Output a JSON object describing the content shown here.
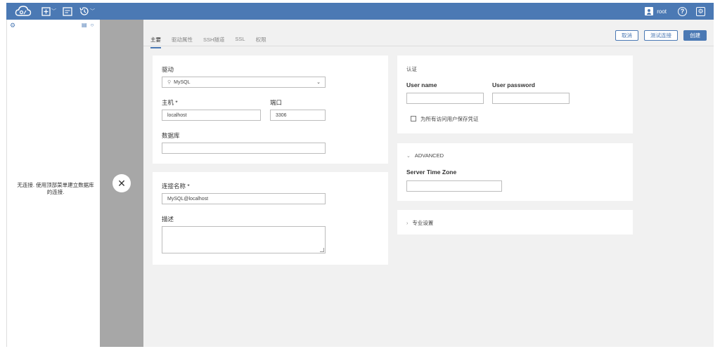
{
  "header": {
    "user": "root",
    "help_glyph": "?",
    "settings_glyph": "⚙"
  },
  "sidebar": {
    "empty_message": "无连接. 使用顶部菜单建立数据库的连接."
  },
  "close_glyph": "✕",
  "tabs": [
    {
      "label": "主要"
    },
    {
      "label": "驱动属性"
    },
    {
      "label": "SSH隧道"
    },
    {
      "label": "SSL"
    },
    {
      "label": "权限"
    }
  ],
  "actions": {
    "cancel": "取消",
    "test": "测试连接",
    "create": "创建"
  },
  "driver_card": {
    "driver_label": "驱动",
    "driver_value": "MySQL",
    "host_label": "主机 *",
    "host_value": "localhost",
    "port_label": "端口",
    "port_value": "3306",
    "database_label": "数据库",
    "database_value": ""
  },
  "name_card": {
    "name_label": "连接名称 *",
    "name_value": "MySQL@localhost",
    "desc_label": "描述"
  },
  "auth_card": {
    "title": "认证",
    "username_label": "User name",
    "password_label": "User password",
    "save_creds_label": "为所有访问用户保存凭证"
  },
  "advanced_card": {
    "title": "ADVANCED",
    "timezone_label": "Server Time Zone"
  },
  "pro_card": {
    "title": "专业设置"
  }
}
